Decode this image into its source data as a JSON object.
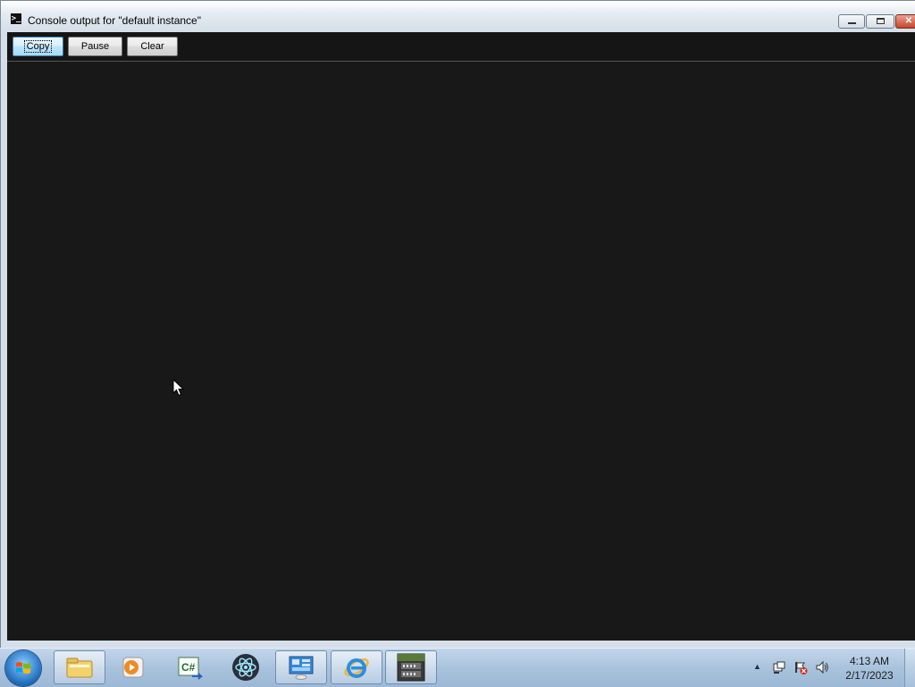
{
  "window": {
    "title": "Console output for \"default instance\"",
    "controls": {
      "minimize": "minimize",
      "maximize": "maximize",
      "close": "close"
    }
  },
  "toolbar": {
    "copy_label": "Copy",
    "pause_label": "Pause",
    "clear_label": "Clear"
  },
  "console": {
    "output": ""
  },
  "taskbar": {
    "items": [
      {
        "name": "file-explorer",
        "icon": "folder-icon"
      },
      {
        "name": "media-player",
        "icon": "media-player-icon"
      },
      {
        "name": "csharp",
        "icon": "csharp-icon"
      },
      {
        "name": "electron-app",
        "icon": "atom-icon"
      },
      {
        "name": "control-panel",
        "icon": "control-panel-icon"
      },
      {
        "name": "internet-explorer",
        "icon": "ie-icon"
      },
      {
        "name": "betacraft",
        "icon": "betacraft-icon"
      }
    ]
  },
  "tray": {
    "time": "4:13 AM",
    "date": "2/17/2023"
  },
  "colors": {
    "console_bg": "#181818",
    "taskbar": "#a9c3dd",
    "window_frame": "#d4dfe9"
  }
}
